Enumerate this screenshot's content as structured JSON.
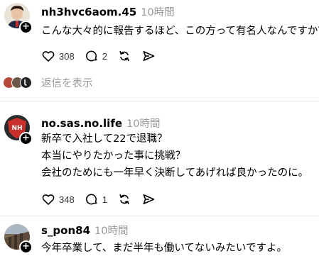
{
  "posts": [
    {
      "username": "nh3hvc6aom.45",
      "time": "10時間",
      "text": [
        "こんな大々的に報告するほど、この方って有名人なんですか？"
      ],
      "likes": "308",
      "replies": "2"
    },
    {
      "username": "no.sas.no.life",
      "time": "10時間",
      "text": [
        "新卒で入社して22で退職？",
        "本当にやりたかった事に挑戦？",
        "会社のためにも一年早く決断してあげれば良かったのに。"
      ],
      "likes": "348",
      "replies": "1"
    },
    {
      "username": "s_pon84",
      "time": "10時間",
      "text": [
        "今年卒業して、まだ半年も働いてないみたいですよ。"
      ]
    }
  ],
  "show_replies_label": "返信を表示",
  "avatar2_text": "NH",
  "colors": {
    "muted": "#999999",
    "divider": "#e5e5e5"
  },
  "icons": [
    "heart-icon",
    "comment-icon",
    "repost-icon",
    "share-icon",
    "plus-icon"
  ]
}
